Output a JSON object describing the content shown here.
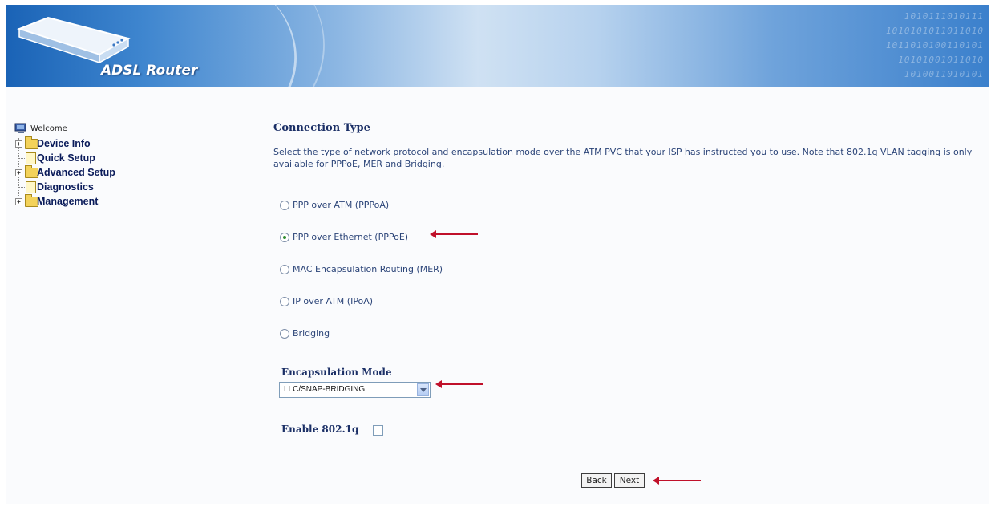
{
  "banner": {
    "brand": "ADSL Router",
    "binary_lines": [
      "1010111010111",
      "1010101011011010",
      "1011010100110101",
      "10101001011010",
      "1010011010101"
    ]
  },
  "nav": {
    "welcome": "Welcome",
    "items": [
      {
        "label": "Device Info",
        "expandable": true
      },
      {
        "label": "Quick Setup",
        "expandable": false
      },
      {
        "label": "Advanced Setup",
        "expandable": true
      },
      {
        "label": "Diagnostics",
        "expandable": false
      },
      {
        "label": "Management",
        "expandable": true
      }
    ]
  },
  "main": {
    "title": "Connection Type",
    "description": "Select the type of network protocol and encapsulation mode over the ATM PVC that your ISP has instructed you to use. Note that 802.1q VLAN tagging is only available for PPPoE, MER and Bridging.",
    "options": [
      {
        "label": "PPP over ATM (PPPoA)",
        "checked": false
      },
      {
        "label": "PPP over Ethernet (PPPoE)",
        "checked": true
      },
      {
        "label": "MAC Encapsulation Routing (MER)",
        "checked": false
      },
      {
        "label": "IP over ATM (IPoA)",
        "checked": false
      },
      {
        "label": "Bridging",
        "checked": false
      }
    ],
    "encapsulation_label": "Encapsulation Mode",
    "encapsulation_value": "LLC/SNAP-BRIDGING",
    "enable_8021q_label": "Enable 802.1q",
    "enable_8021q_checked": false,
    "back_label": "Back",
    "next_label": "Next"
  },
  "colors": {
    "annotation_arrow": "#c0102a",
    "title_text": "#1b2f66",
    "body_text": "#2b4478"
  }
}
